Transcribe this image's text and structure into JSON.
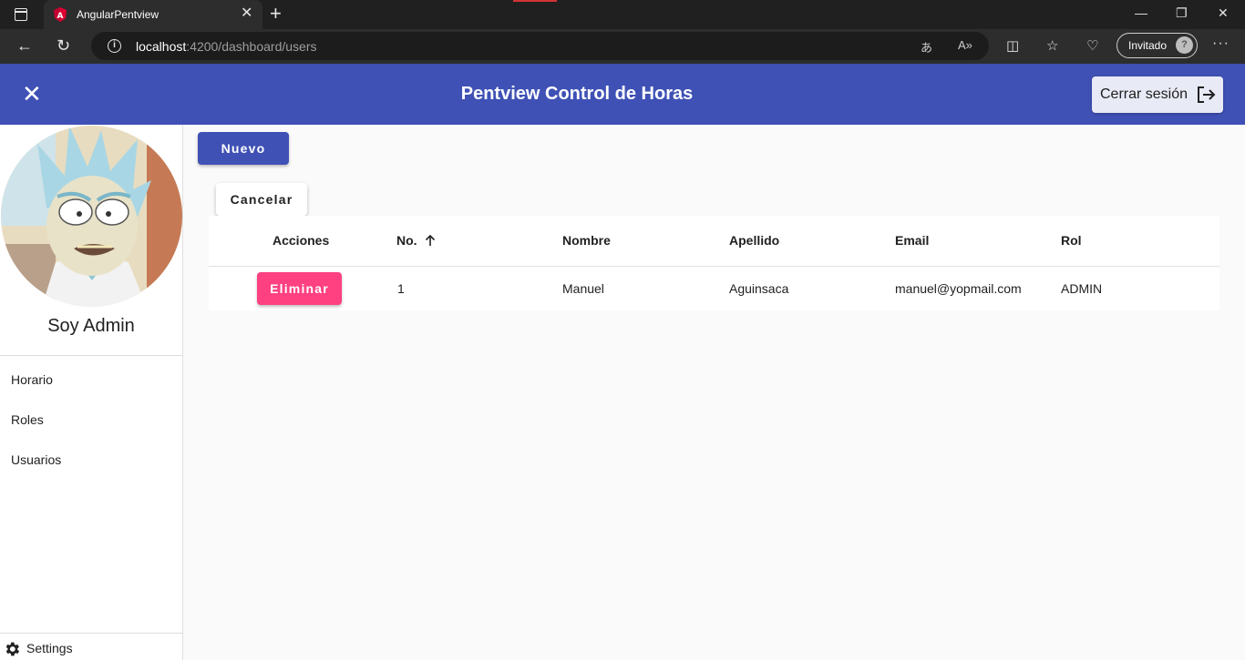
{
  "browser": {
    "tab_title": "AngularPentview",
    "url_host": "localhost",
    "url_path": ":4200/dashboard/users",
    "profile_label": "Invitado"
  },
  "toolbar": {
    "title": "Pentview Control de Horas",
    "logout_label": "Cerrar sesión",
    "color": "#3f51b5"
  },
  "sidebar": {
    "user_name": "Soy Admin",
    "items": [
      {
        "label": "Horario"
      },
      {
        "label": "Roles"
      },
      {
        "label": "Usuarios"
      }
    ],
    "settings_label": "Settings"
  },
  "actions": {
    "new_label": "Nuevo",
    "cancel_label": "Cancelar"
  },
  "table": {
    "headers": {
      "actions": "Acciones",
      "number": "No.",
      "name": "Nombre",
      "lastname": "Apellido",
      "email": "Email",
      "role": "Rol"
    },
    "sort_icon": "arrow-up-icon",
    "rows": [
      {
        "delete_label": "Eliminar",
        "number": "1",
        "name": "Manuel",
        "lastname": "Aguinsaca",
        "email": "manuel@yopmail.com",
        "role": "ADMIN"
      }
    ]
  },
  "colors": {
    "primary": "#3f51b5",
    "accent": "#ff4081"
  }
}
